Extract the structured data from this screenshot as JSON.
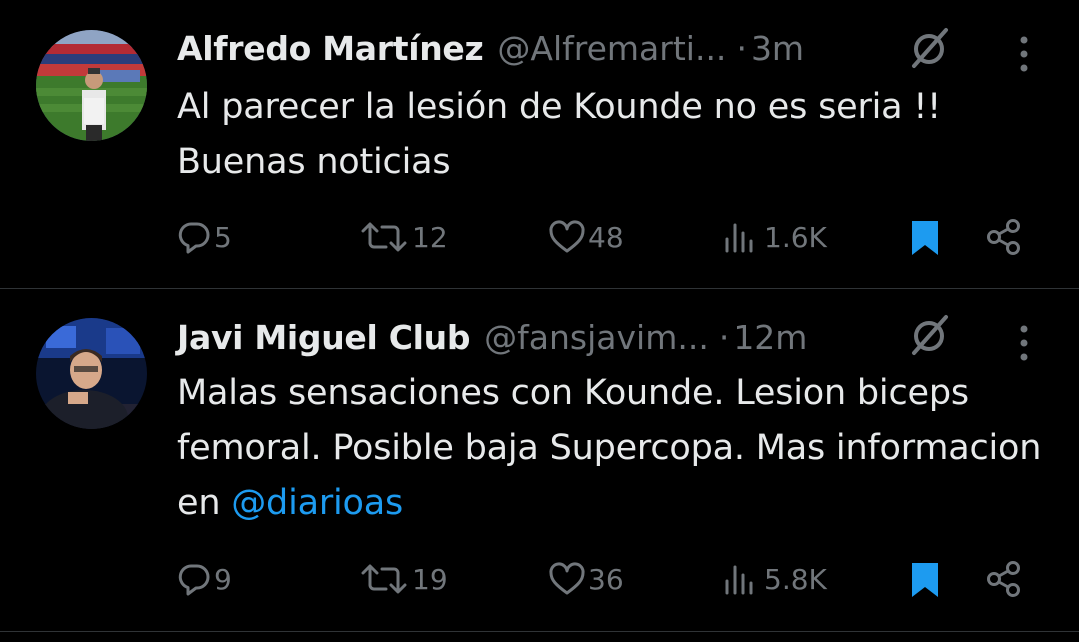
{
  "colors": {
    "background": "#000000",
    "primary_text": "#e7e9ea",
    "secondary_text": "#71767b",
    "accent": "#1d9bf0",
    "divider": "#2f3336"
  },
  "tweets": [
    {
      "author": {
        "name": "Alfredo Martínez",
        "handle": "@Alfremarti...",
        "avatar_icon": "stadium-photo"
      },
      "separator": "·",
      "time": "3m",
      "text": "Al parecer la lesión de Kounde no es seria !! Buenas noticias",
      "text_prefix": "",
      "mention": "",
      "stats": {
        "replies": "5",
        "retweets": "12",
        "likes": "48",
        "views": "1.6K"
      },
      "bookmarked": true
    },
    {
      "author": {
        "name": "Javi Miguel Club",
        "handle": "@fansjavim...",
        "avatar_icon": "tv-studio-photo"
      },
      "separator": "·",
      "time": "12m",
      "text": "",
      "text_prefix": "Malas sensaciones con Kounde. Lesion biceps femoral. Posible baja Supercopa. Mas informacion en ",
      "mention": "@diarioas",
      "stats": {
        "replies": "9",
        "retweets": "19",
        "likes": "36",
        "views": "5.8K"
      },
      "bookmarked": true
    }
  ]
}
